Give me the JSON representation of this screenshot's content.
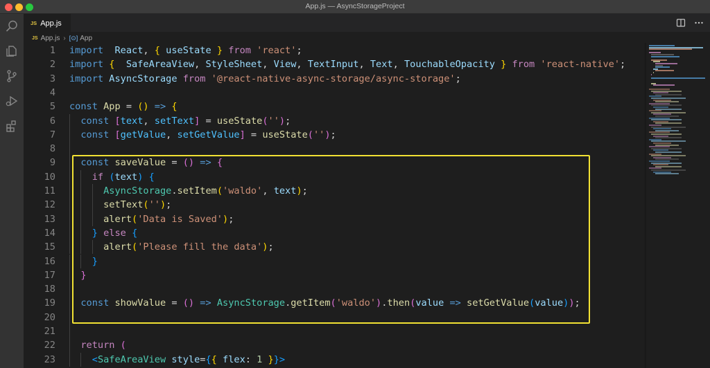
{
  "window": {
    "title": "App.js — AsyncStorageProject"
  },
  "tab": {
    "icon_label": "JS",
    "label": "App.js"
  },
  "breadcrumb": {
    "icon_label": "JS",
    "file": "App.js",
    "symbol_icon": "symbol-variable-icon",
    "symbol": "App"
  },
  "activity_bar": [
    "search-icon",
    "files-icon",
    "source-control-icon",
    "run-debug-icon",
    "extensions-icon"
  ],
  "editor_actions": [
    "split-editor-icon",
    "more-actions-icon"
  ],
  "colors": {
    "highlight_border": "#f2e233",
    "keyword": "#569cd6",
    "string": "#ce9178",
    "function": "#dcdcaa",
    "variable": "#9cdcfe"
  },
  "lines": [
    {
      "n": "1",
      "indent": 0,
      "tokens": [
        [
          "kw",
          "import"
        ],
        [
          "",
          "  "
        ],
        [
          "var",
          "React"
        ],
        [
          "",
          ", "
        ],
        [
          "br1",
          "{"
        ],
        [
          "",
          " "
        ],
        [
          "var",
          "useState"
        ],
        [
          "",
          " "
        ],
        [
          "br1",
          "}"
        ],
        [
          "",
          " "
        ],
        [
          "ctrl",
          "from"
        ],
        [
          "",
          " "
        ],
        [
          "str",
          "'react'"
        ],
        [
          "",
          ";"
        ]
      ]
    },
    {
      "n": "2",
      "indent": 0,
      "tokens": [
        [
          "kw",
          "import"
        ],
        [
          "",
          " "
        ],
        [
          "br1",
          "{"
        ],
        [
          "",
          "  "
        ],
        [
          "var",
          "SafeAreaView"
        ],
        [
          "",
          ", "
        ],
        [
          "var",
          "StyleSheet"
        ],
        [
          "",
          ", "
        ],
        [
          "var",
          "View"
        ],
        [
          "",
          ", "
        ],
        [
          "var",
          "TextInput"
        ],
        [
          "",
          ", "
        ],
        [
          "var",
          "Text"
        ],
        [
          "",
          ", "
        ],
        [
          "var",
          "TouchableOpacity"
        ],
        [
          "",
          " "
        ],
        [
          "br1",
          "}"
        ],
        [
          "",
          " "
        ],
        [
          "ctrl",
          "from"
        ],
        [
          "",
          " "
        ],
        [
          "str",
          "'react-native'"
        ],
        [
          "",
          ";"
        ]
      ]
    },
    {
      "n": "3",
      "indent": 0,
      "tokens": [
        [
          "kw",
          "import"
        ],
        [
          "",
          " "
        ],
        [
          "var",
          "AsyncStorage"
        ],
        [
          "",
          " "
        ],
        [
          "ctrl",
          "from"
        ],
        [
          "",
          " "
        ],
        [
          "str",
          "'@react-native-async-storage/async-storage'"
        ],
        [
          "",
          ";"
        ]
      ]
    },
    {
      "n": "4",
      "indent": 0,
      "tokens": []
    },
    {
      "n": "5",
      "indent": 0,
      "tokens": [
        [
          "kw",
          "const"
        ],
        [
          "",
          " "
        ],
        [
          "fn",
          "App"
        ],
        [
          "",
          " = "
        ],
        [
          "br1",
          "("
        ],
        [
          "br1",
          ")"
        ],
        [
          "",
          " "
        ],
        [
          "kw",
          "=>"
        ],
        [
          "",
          " "
        ],
        [
          "br1",
          "{"
        ]
      ]
    },
    {
      "n": "6",
      "indent": 1,
      "tokens": [
        [
          "kw",
          "const"
        ],
        [
          "",
          " "
        ],
        [
          "br2",
          "["
        ],
        [
          "const",
          "text"
        ],
        [
          "",
          ", "
        ],
        [
          "const",
          "setText"
        ],
        [
          "br2",
          "]"
        ],
        [
          "",
          " = "
        ],
        [
          "fn",
          "useState"
        ],
        [
          "br2",
          "("
        ],
        [
          "str",
          "''"
        ],
        [
          "br2",
          ")"
        ],
        [
          "",
          ";"
        ]
      ]
    },
    {
      "n": "7",
      "indent": 1,
      "tokens": [
        [
          "kw",
          "const"
        ],
        [
          "",
          " "
        ],
        [
          "br2",
          "["
        ],
        [
          "const",
          "getValue"
        ],
        [
          "",
          ", "
        ],
        [
          "const",
          "setGetValue"
        ],
        [
          "br2",
          "]"
        ],
        [
          "",
          " = "
        ],
        [
          "fn",
          "useState"
        ],
        [
          "br2",
          "("
        ],
        [
          "str",
          "''"
        ],
        [
          "br2",
          ")"
        ],
        [
          "",
          ";"
        ]
      ]
    },
    {
      "n": "8",
      "indent": 1,
      "tokens": []
    },
    {
      "n": "9",
      "indent": 1,
      "tokens": [
        [
          "kw",
          "const"
        ],
        [
          "",
          " "
        ],
        [
          "fn",
          "saveValue"
        ],
        [
          "",
          " = "
        ],
        [
          "br2",
          "("
        ],
        [
          "br2",
          ")"
        ],
        [
          "",
          " "
        ],
        [
          "kw",
          "=>"
        ],
        [
          "",
          " "
        ],
        [
          "br2",
          "{"
        ]
      ]
    },
    {
      "n": "10",
      "indent": 2,
      "tokens": [
        [
          "ctrl",
          "if"
        ],
        [
          "",
          " "
        ],
        [
          "br3",
          "("
        ],
        [
          "var",
          "text"
        ],
        [
          "br3",
          ")"
        ],
        [
          "",
          " "
        ],
        [
          "br3",
          "{"
        ]
      ]
    },
    {
      "n": "11",
      "indent": 3,
      "tokens": [
        [
          "cls",
          "AsyncStorage"
        ],
        [
          "",
          "."
        ],
        [
          "fn",
          "setItem"
        ],
        [
          "br1",
          "("
        ],
        [
          "str",
          "'waldo'"
        ],
        [
          "",
          ", "
        ],
        [
          "var",
          "text"
        ],
        [
          "br1",
          ")"
        ],
        [
          "",
          ";"
        ]
      ]
    },
    {
      "n": "12",
      "indent": 3,
      "tokens": [
        [
          "fn",
          "setText"
        ],
        [
          "br1",
          "("
        ],
        [
          "str",
          "''"
        ],
        [
          "br1",
          ")"
        ],
        [
          "",
          ";"
        ]
      ]
    },
    {
      "n": "13",
      "indent": 3,
      "tokens": [
        [
          "fn",
          "alert"
        ],
        [
          "br1",
          "("
        ],
        [
          "str",
          "'Data is Saved'"
        ],
        [
          "br1",
          ")"
        ],
        [
          "",
          ";"
        ]
      ]
    },
    {
      "n": "14",
      "indent": 2,
      "tokens": [
        [
          "br3",
          "}"
        ],
        [
          "",
          " "
        ],
        [
          "ctrl",
          "else"
        ],
        [
          "",
          " "
        ],
        [
          "br3",
          "{"
        ]
      ]
    },
    {
      "n": "15",
      "indent": 3,
      "tokens": [
        [
          "fn",
          "alert"
        ],
        [
          "br1",
          "("
        ],
        [
          "str",
          "'Please fill the data'"
        ],
        [
          "br1",
          ")"
        ],
        [
          "",
          ";"
        ]
      ]
    },
    {
      "n": "16",
      "indent": 2,
      "tokens": [
        [
          "br3",
          "}"
        ]
      ]
    },
    {
      "n": "17",
      "indent": 1,
      "tokens": [
        [
          "br2",
          "}"
        ]
      ]
    },
    {
      "n": "18",
      "indent": 1,
      "tokens": []
    },
    {
      "n": "19",
      "indent": 1,
      "tokens": [
        [
          "kw",
          "const"
        ],
        [
          "",
          " "
        ],
        [
          "fn",
          "showValue"
        ],
        [
          "",
          " = "
        ],
        [
          "br2",
          "("
        ],
        [
          "br2",
          ")"
        ],
        [
          "",
          " "
        ],
        [
          "kw",
          "=>"
        ],
        [
          "",
          " "
        ],
        [
          "cls",
          "AsyncStorage"
        ],
        [
          "",
          "."
        ],
        [
          "fn",
          "getItem"
        ],
        [
          "br2",
          "("
        ],
        [
          "str",
          "'waldo'"
        ],
        [
          "br2",
          ")"
        ],
        [
          "",
          "."
        ],
        [
          "fn",
          "then"
        ],
        [
          "br2",
          "("
        ],
        [
          "var",
          "value"
        ],
        [
          "",
          " "
        ],
        [
          "kw",
          "=>"
        ],
        [
          "",
          " "
        ],
        [
          "fn",
          "setGetValue"
        ],
        [
          "br3",
          "("
        ],
        [
          "var",
          "value"
        ],
        [
          "br3",
          ")"
        ],
        [
          "br2",
          ")"
        ],
        [
          "",
          ";"
        ]
      ]
    },
    {
      "n": "20",
      "indent": 1,
      "tokens": []
    },
    {
      "n": "21",
      "indent": 1,
      "tokens": []
    },
    {
      "n": "22",
      "indent": 1,
      "tokens": [
        [
          "ctrl",
          "return"
        ],
        [
          "",
          " "
        ],
        [
          "br2",
          "("
        ]
      ]
    },
    {
      "n": "23",
      "indent": 2,
      "tokens": [
        [
          "br3",
          "<"
        ],
        [
          "cls",
          "SafeAreaView"
        ],
        [
          "",
          " "
        ],
        [
          "var",
          "style"
        ],
        [
          "",
          "="
        ],
        [
          "br3",
          "{"
        ],
        [
          "br1",
          "{"
        ],
        [
          "",
          " "
        ],
        [
          "var",
          "flex"
        ],
        [
          "",
          ": "
        ],
        [
          "num",
          "1"
        ],
        [
          "",
          " "
        ],
        [
          "br1",
          "}"
        ],
        [
          "br3",
          "}"
        ],
        [
          "br3",
          ">"
        ]
      ]
    }
  ]
}
